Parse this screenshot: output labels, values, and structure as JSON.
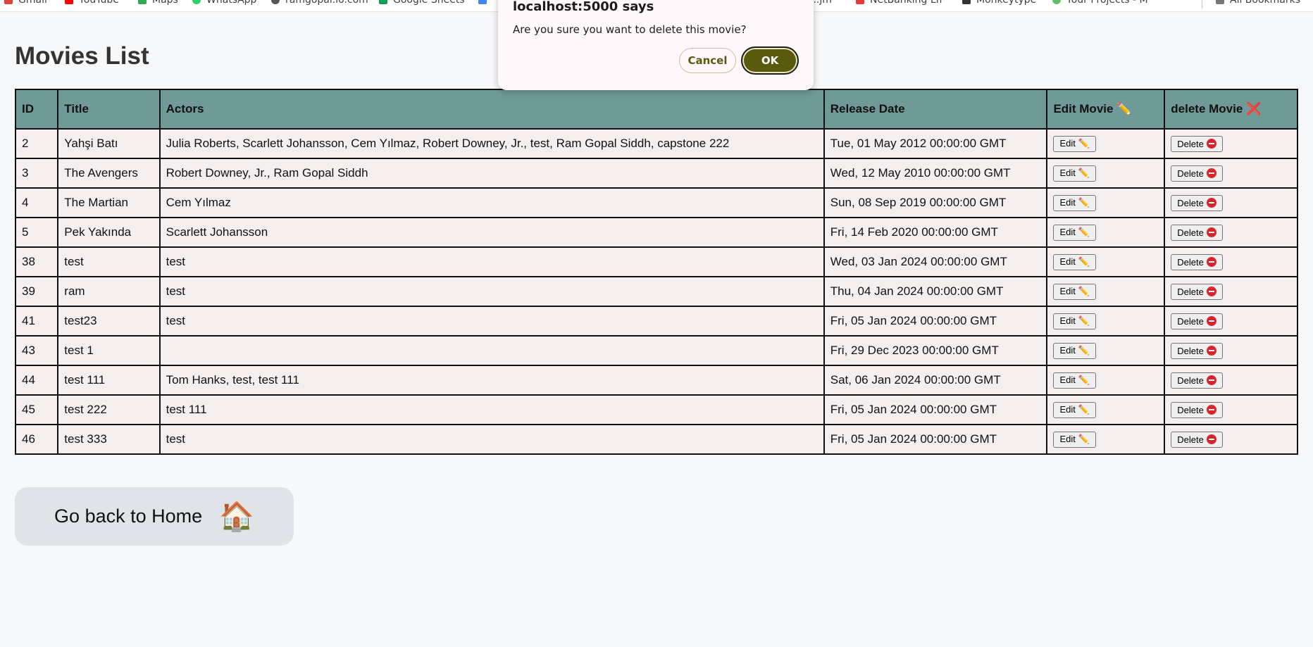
{
  "bookmarks": [
    {
      "label": "Gmail",
      "color": "#db4437"
    },
    {
      "label": "YouTube",
      "color": "#ff0000"
    },
    {
      "label": "Maps",
      "color": "#34a853"
    },
    {
      "label": "WhatsApp",
      "color": "#25d366"
    },
    {
      "label": "ramgopal.io.com",
      "color": "#555555"
    },
    {
      "label": "Google Sheets",
      "color": "#0f9d58"
    },
    {
      "label": "",
      "color": "#4285f4"
    },
    {
      "label": "...jm",
      "color": "#888888"
    },
    {
      "label": "NetBanking Lfl",
      "color": "#e53935"
    },
    {
      "label": "Monkeytype",
      "color": "#333333"
    },
    {
      "label": "Your Projects - M",
      "color": "#66bb6a"
    },
    {
      "label": "All Bookmarks",
      "color": "#777777"
    }
  ],
  "page": {
    "title": "Movies List"
  },
  "table": {
    "headers": {
      "id": "ID",
      "title": "Title",
      "actors": "Actors",
      "release_date": "Release Date",
      "edit": "Edit Movie ✏️",
      "delete": "delete Movie ❌"
    },
    "edit_label": "Edit ✏️",
    "delete_label": "Delete",
    "rows": [
      {
        "id": "2",
        "title": "Yahşi Batı",
        "actors": "Julia Roberts, Scarlett Johansson, Cem Yılmaz, Robert Downey, Jr., test, Ram Gopal Siddh, capstone 222",
        "release_date": "Tue, 01 May 2012 00:00:00 GMT"
      },
      {
        "id": "3",
        "title": "The Avengers",
        "actors": "Robert Downey, Jr., Ram Gopal Siddh",
        "release_date": "Wed, 12 May 2010 00:00:00 GMT"
      },
      {
        "id": "4",
        "title": "The Martian",
        "actors": "Cem Yılmaz",
        "release_date": "Sun, 08 Sep 2019 00:00:00 GMT"
      },
      {
        "id": "5",
        "title": "Pek Yakında",
        "actors": "Scarlett Johansson",
        "release_date": "Fri, 14 Feb 2020 00:00:00 GMT"
      },
      {
        "id": "38",
        "title": "test",
        "actors": "test",
        "release_date": "Wed, 03 Jan 2024 00:00:00 GMT"
      },
      {
        "id": "39",
        "title": "ram",
        "actors": "test",
        "release_date": "Thu, 04 Jan 2024 00:00:00 GMT"
      },
      {
        "id": "41",
        "title": "test23",
        "actors": "test",
        "release_date": "Fri, 05 Jan 2024 00:00:00 GMT"
      },
      {
        "id": "43",
        "title": "test 1",
        "actors": "",
        "release_date": "Fri, 29 Dec 2023 00:00:00 GMT"
      },
      {
        "id": "44",
        "title": "test 111",
        "actors": "Tom Hanks, test, test 111",
        "release_date": "Sat, 06 Jan 2024 00:00:00 GMT"
      },
      {
        "id": "45",
        "title": "test 222",
        "actors": "test 111",
        "release_date": "Fri, 05 Jan 2024 00:00:00 GMT"
      },
      {
        "id": "46",
        "title": "test 333",
        "actors": "test",
        "release_date": "Fri, 05 Jan 2024 00:00:00 GMT"
      }
    ]
  },
  "home_button": {
    "label": "Go back to Home",
    "icon": "🏠"
  },
  "dialog": {
    "title": "localhost:5000 says",
    "message": "Are you sure you want to delete this movie?",
    "cancel_label": "Cancel",
    "ok_label": "OK"
  },
  "colors": {
    "table_header_bg": "#6f9a97",
    "table_row_bg": "#f4efee",
    "dialog_ok_bg": "#5a5a0f",
    "home_button_bg": "#e0e4e8"
  }
}
